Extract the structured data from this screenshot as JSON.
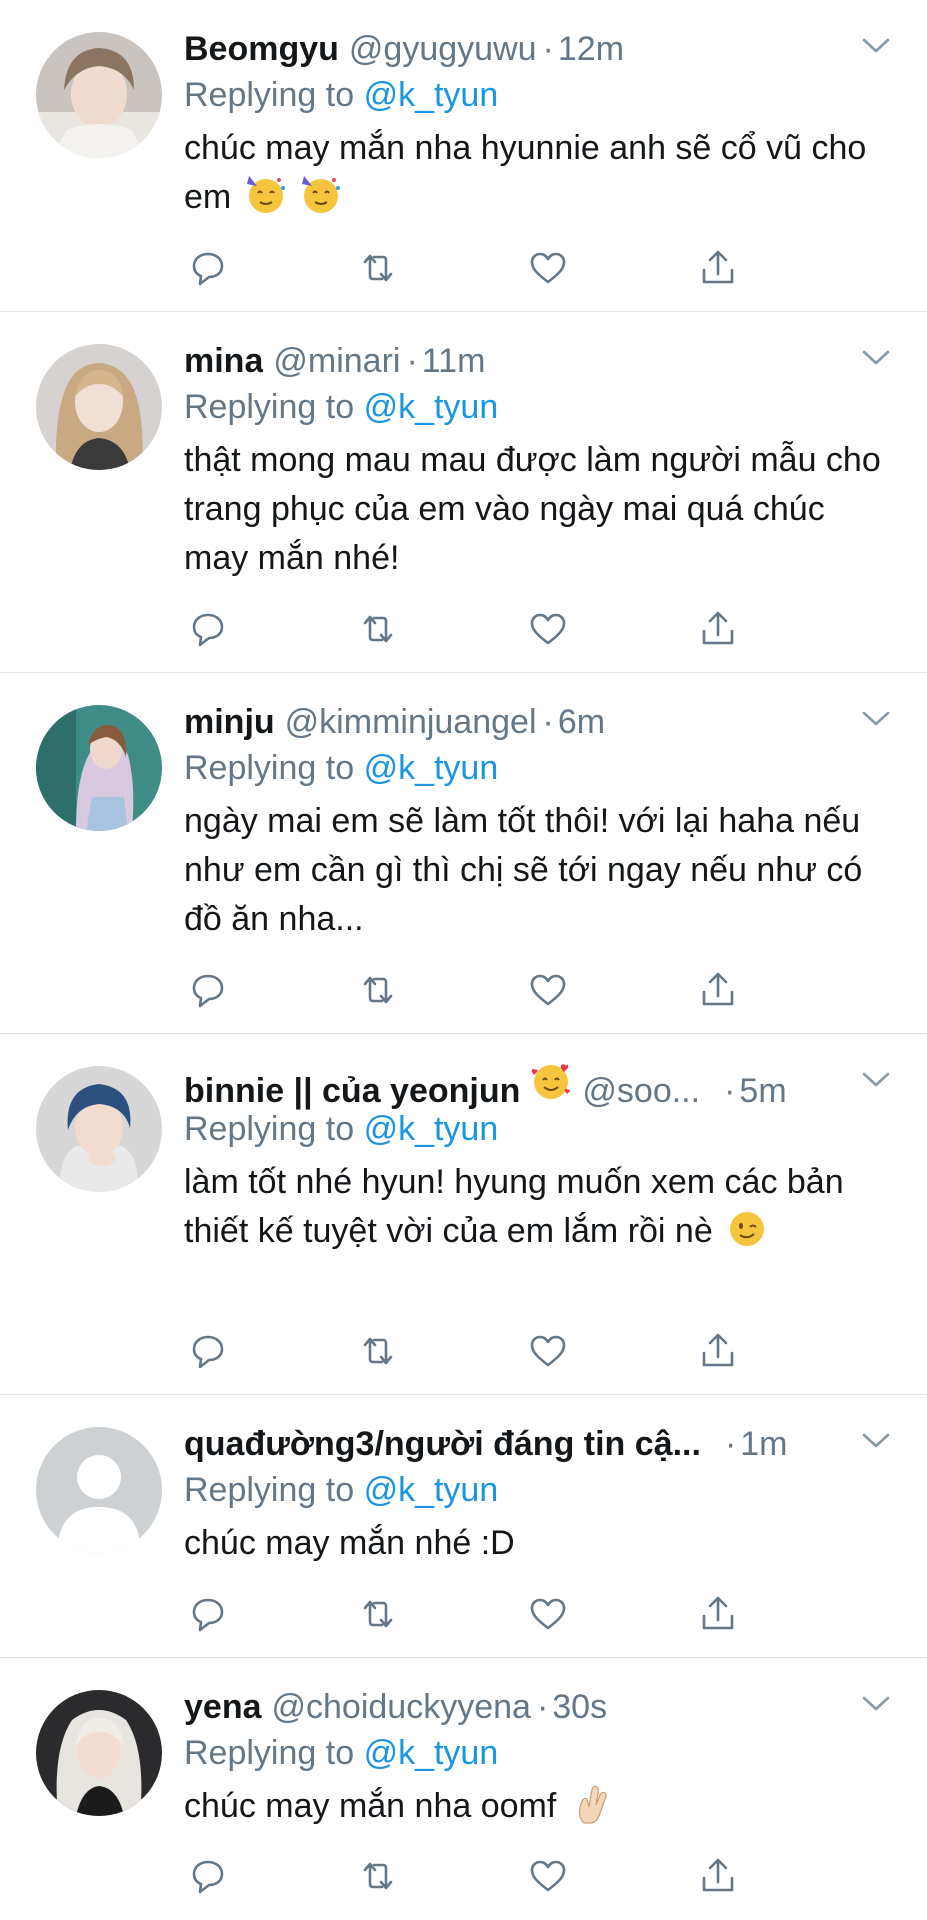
{
  "reply_prefix": "Replying to",
  "reply_target": "@k_tyun",
  "colors": {
    "name": "#14171a",
    "muted": "#657786",
    "link": "#1b95e0",
    "divider": "#e3e6e8"
  },
  "action_icons": [
    "reply-icon",
    "retweet-icon",
    "like-icon",
    "share-icon"
  ],
  "tweets": [
    {
      "name": "Beomgyu",
      "handle": "@gyugyuwu",
      "time": "12m",
      "text": "chúc may mắn nha hyunnie anh sẽ cổ vũ cho em",
      "emojis": [
        "partying-face-emoji",
        "partying-face-emoji"
      ]
    },
    {
      "name": "mina",
      "handle": "@minari",
      "time": "11m",
      "text": "thật mong mau mau được làm người mẫu cho trang phục của em vào ngày mai quá chúc may mắn nhé!",
      "emojis": []
    },
    {
      "name": "minju",
      "handle": "@kimminjuangel",
      "time": "6m",
      "text": "ngày mai em sẽ làm tốt thôi! với lại haha nếu như em cần gì thì chị sẽ tới ngay nếu như có đồ ăn nha...",
      "emojis": []
    },
    {
      "name": "binnie || của yeonjun",
      "handle": "@soo...",
      "time": "5m",
      "text": "làm tốt nhé hyun! hyung muốn xem các bản thiết kế tuyệt vời của em lắm rồi nè",
      "emojis": [
        "winking-face-emoji"
      ],
      "name_emoji": "smiling-face-with-hearts-emoji"
    },
    {
      "name": "quađường3/người đáng tin cậ...",
      "handle": "",
      "time": "1m",
      "text": "chúc may mắn nhé :D",
      "emojis": [],
      "default_avatar": true
    },
    {
      "name": "yena",
      "handle": "@choiduckyyena",
      "time": "30s",
      "text": "chúc may mắn nha oomf",
      "emojis": [
        "crossed-fingers-emoji"
      ]
    }
  ]
}
